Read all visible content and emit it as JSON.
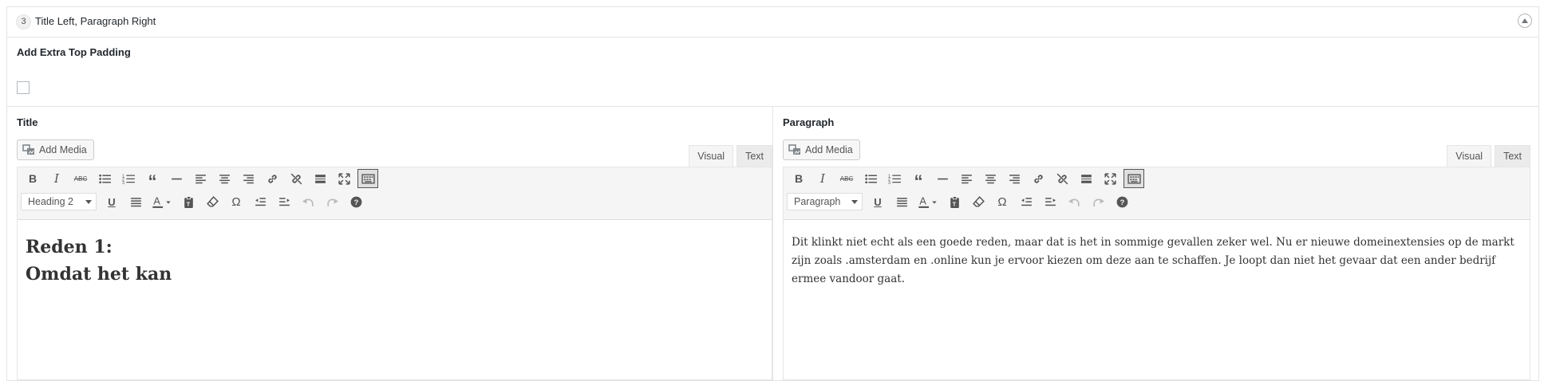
{
  "layout": {
    "number": "3",
    "title": "Title Left, Paragraph Right"
  },
  "padding_field": {
    "label": "Add Extra Top Padding",
    "checked": false
  },
  "left": {
    "label": "Title",
    "add_media": "Add Media",
    "tabs": [
      "Visual",
      "Text"
    ],
    "format": "Heading 2",
    "content_lines": [
      "Reden 1:",
      "Omdat het kan"
    ]
  },
  "right": {
    "label": "Paragraph",
    "add_media": "Add Media",
    "tabs": [
      "Visual",
      "Text"
    ],
    "format": "Paragraph",
    "content": "Dit klinkt niet echt als een goede reden, maar dat is het in sommige gevallen zeker wel. Nu er nieuwe domeinextensies op de markt zijn zoals .amsterdam en .online kun je ervoor kiezen om deze aan te schaffen. Je loopt dan niet het gevaar dat een ander bedrijf ermee vandoor gaat."
  },
  "toolbar": {
    "row1": [
      "bold-icon",
      "italic-icon",
      "strikethrough-icon",
      "bullet-list-icon",
      "numbered-list-icon",
      "blockquote-icon",
      "horizontal-line-icon",
      "align-left-icon",
      "align-center-icon",
      "align-right-icon",
      "link-icon",
      "unlink-icon",
      "read-more-icon",
      "fullscreen-icon",
      "toolbar-toggle-icon"
    ],
    "row2": [
      "underline-icon",
      "justify-icon",
      "text-color-icon",
      "paste-text-icon",
      "clear-formatting-icon",
      "special-character-icon",
      "outdent-icon",
      "indent-icon",
      "undo-icon",
      "redo-icon",
      "help-icon"
    ]
  }
}
